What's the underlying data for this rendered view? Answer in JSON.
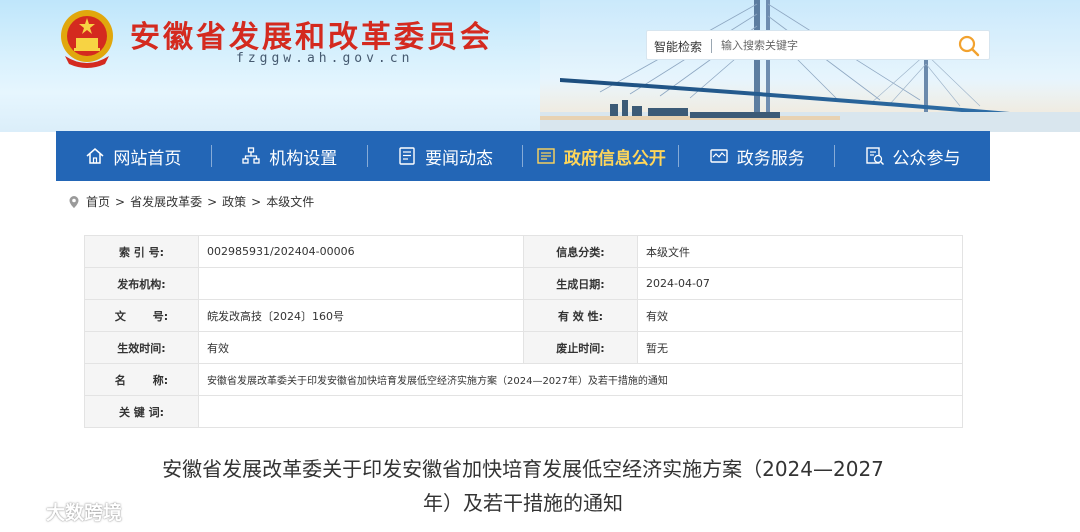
{
  "header": {
    "site_title": "安徽省发展和改革委员会",
    "domain": "fzggw.ah.gov.cn",
    "emblem_icon": "national-emblem-icon",
    "search": {
      "label": "智能检索",
      "placeholder": "输入搜索关键字",
      "button_icon": "search-icon"
    }
  },
  "nav": {
    "items": [
      {
        "label": "网站首页",
        "icon": "home-icon"
      },
      {
        "label": "机构设置",
        "icon": "org-structure-icon"
      },
      {
        "label": "要闻动态",
        "icon": "news-icon"
      },
      {
        "label": "政府信息公开",
        "icon": "info-disclosure-icon",
        "active": true
      },
      {
        "label": "政务服务",
        "icon": "service-icon"
      },
      {
        "label": "公众参与",
        "icon": "participation-icon"
      }
    ],
    "active_color": "#ffd65a",
    "background": "#2366b6"
  },
  "breadcrumb": {
    "items": [
      "首页",
      "省发展改革委",
      "政策",
      "本级文件"
    ],
    "separator": ">"
  },
  "info": {
    "index_label": "索 引 号:",
    "index_value": "002985931/202404-00006",
    "category_label": "信息分类:",
    "category_value": "本级文件",
    "publisher_label": "发布机构:",
    "publisher_value": "",
    "date_label": "生成日期:",
    "date_value": "2024-04-07",
    "docno_label": "文       号:",
    "docno_value": "皖发改高技〔2024〕160号",
    "validity_label": "有 效 性:",
    "validity_value": "有效",
    "effective_label": "生效时间:",
    "effective_value": "有效",
    "repeal_label": "废止时间:",
    "repeal_value": "暂无",
    "name_label": "名       称:",
    "name_value": "安徽省发展改革委关于印发安徽省加快培育发展低空经济实施方案（2024—2027年）及若干措施的通知",
    "keywords_label": "关 键 词:",
    "keywords_value": ""
  },
  "article": {
    "title_line1": "安徽省发展改革委关于印发安徽省加快培育发展低空经济实施方案（2024—2027",
    "title_line2": "年）及若干措施的通知"
  },
  "watermark": {
    "text": "大数跨境"
  }
}
